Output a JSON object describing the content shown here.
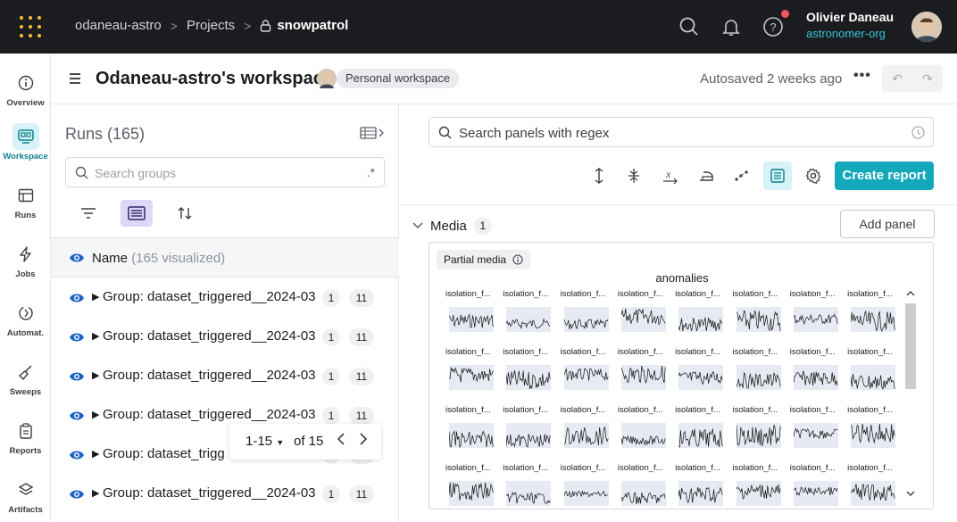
{
  "topbar": {
    "crumbs": [
      "odaneau-astro",
      "Projects"
    ],
    "project": "snowpatrol",
    "user_name": "Olivier Daneau",
    "user_org": "astronomer-org"
  },
  "rail": {
    "items": [
      "Overview",
      "Workspace",
      "Runs",
      "Jobs",
      "Automat.",
      "Sweeps",
      "Reports",
      "Artifacts"
    ]
  },
  "workspace": {
    "title": "Odaneau-astro's workspace",
    "badge": "Personal workspace",
    "autosaved": "Autosaved 2 weeks ago"
  },
  "runs": {
    "title": "Runs (165)",
    "search_placeholder": "Search groups",
    "regex": ".*",
    "name_label": "Name",
    "name_visualized": "(165 visualized)",
    "rows": [
      {
        "name": "Group: dataset_triggered__2024-03",
        "b1": "1",
        "b2": "11"
      },
      {
        "name": "Group: dataset_triggered__2024-03",
        "b1": "1",
        "b2": "11"
      },
      {
        "name": "Group: dataset_triggered__2024-03",
        "b1": "1",
        "b2": "11"
      },
      {
        "name": "Group: dataset_triggered__2024-03",
        "b1": "1",
        "b2": "11"
      },
      {
        "name": "Group: dataset_trigg",
        "b1": "1",
        "b2": "11"
      },
      {
        "name": "Group: dataset_triggered__2024-03",
        "b1": "1",
        "b2": "11"
      }
    ],
    "pager": {
      "range": "1-15",
      "of": "of 15"
    }
  },
  "panels": {
    "search_placeholder": "Search panels with regex",
    "create_report": "Create report",
    "section": "Media",
    "section_count": "1",
    "add_panel": "Add panel",
    "partial_media": "Partial media",
    "chart_title": "anomalies",
    "cell_label": "isolation_f..."
  },
  "colors": {
    "accent": "#13a9ba",
    "topbar": "#1a1c1f",
    "eye": "#1b62c8",
    "logo": "#fcbc32"
  }
}
